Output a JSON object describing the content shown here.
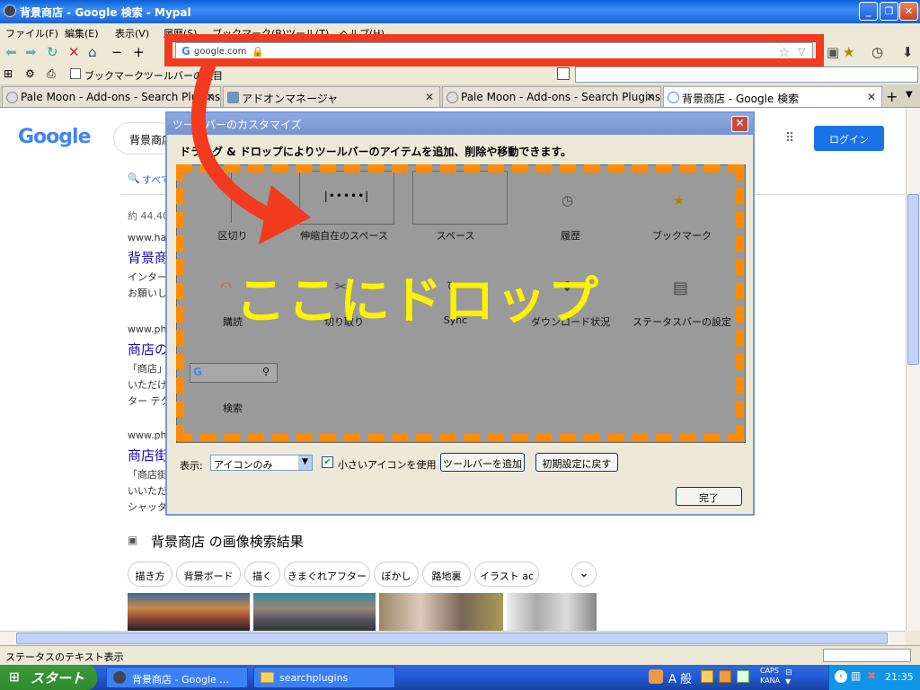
{
  "window": {
    "title": "背景商店 - Google 検索 - Mypal"
  },
  "menu": [
    "ファイル(F)",
    "編集(E)",
    "表示(V)",
    "履歴(S)",
    "ブックマーク(B)",
    "ツール(T)",
    "ヘルプ(H)"
  ],
  "urlbar": {
    "url": "google.com"
  },
  "bookmarks": {
    "item": "ブックマークツールバーの項目"
  },
  "tabs": [
    {
      "label": "Pale Moon - Add-ons - Search Plugins"
    },
    {
      "label": "アドオンマネージャ"
    },
    {
      "label": "Pale Moon - Add-ons - Search Plugins"
    },
    {
      "label": "背景商店 - Google 検索"
    }
  ],
  "google": {
    "logo": "Google",
    "query": "背景商店",
    "login": "ログイン",
    "tab_all": "すべて",
    "result_count": "約 44,40",
    "results": [
      {
        "url": "www.ha",
        "title": "背景商",
        "snippet1": "インター",
        "snippet2": "お願いし"
      },
      {
        "url": "www.ph",
        "title": "商店の",
        "snippet1": "「商店」の",
        "snippet2": "いただけ",
        "snippet3": "ター テク"
      },
      {
        "url": "www.ph",
        "title": "商店街",
        "snippet1": "「商店街",
        "snippet2": "いいただ",
        "snippet3": "シャッター"
      }
    ],
    "images_heading": "背景商店 の画像検索結果",
    "chips": [
      "描き方",
      "背景ボード",
      "描く",
      "きまぐれアフター",
      "ぼかし",
      "路地裏",
      "イラスト ac"
    ]
  },
  "dialog": {
    "title": "ツールバーのカスタマイズ",
    "instruction": "ドラッグ & ドロップによりツールバーのアイテムを追加、削除や移動できます。",
    "items": [
      {
        "label": "区切り",
        "icon": "separator-icon"
      },
      {
        "label": "伸縮自在のスペース",
        "icon": "flexible-space-icon"
      },
      {
        "label": "スペース",
        "icon": "space-icon"
      },
      {
        "label": "履歴",
        "icon": "clock-icon"
      },
      {
        "label": "ブックマーク",
        "icon": "star-icon"
      },
      {
        "label": "購読",
        "icon": "rss-icon"
      },
      {
        "label": "切り取り",
        "icon": "scissors-icon"
      },
      {
        "label": "Sync",
        "icon": "sync-icon"
      },
      {
        "label": "ダウンロード状況",
        "icon": "download-icon"
      },
      {
        "label": "ステータスバーの設定",
        "icon": "statusbar-icon"
      },
      {
        "label": "検索",
        "icon": "search-box-icon"
      }
    ],
    "show_label": "表示:",
    "show_value": "アイコンのみ",
    "small_icons_label": "小さいアイコンを使用",
    "add_toolbar": "ツールバーを追加",
    "restore_default": "初期設定に戻す",
    "done": "完了"
  },
  "overlay": {
    "drop_message": "ここにドロップ",
    "drop_zone_color": "#FF8C00",
    "highlight_color": "#F23A1E",
    "text_color": "#FFF200"
  },
  "status": {
    "text": "ステータスのテキスト表示"
  },
  "taskbar": {
    "start": "スタート",
    "buttons": [
      "背景商店 - Google ...",
      "searchplugins"
    ],
    "ime": "A 般",
    "caps": "CAPS",
    "kana": "KANA",
    "clock": "21:35"
  }
}
